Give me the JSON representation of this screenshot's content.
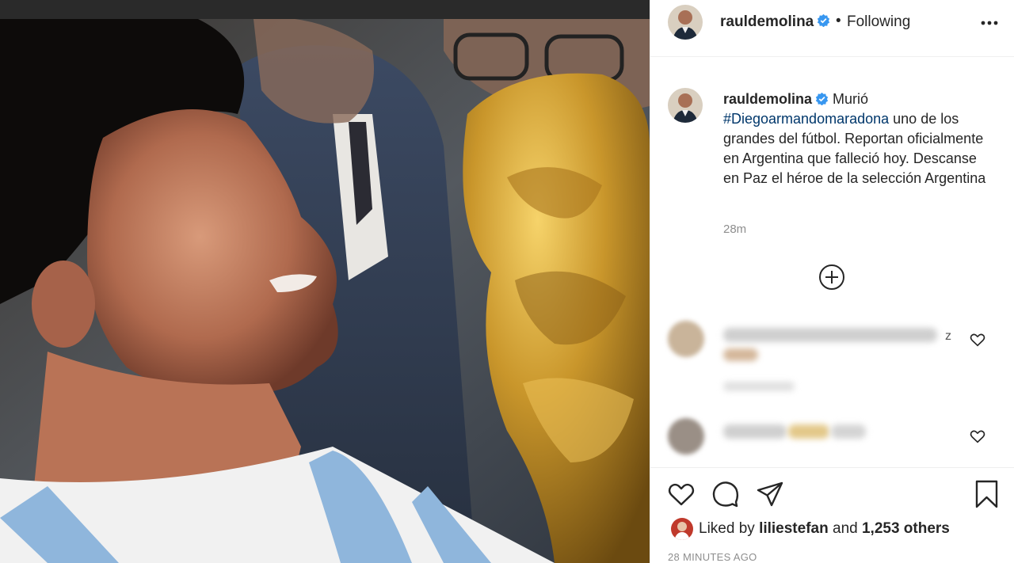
{
  "post": {
    "username": "rauldemolina",
    "following_label": "Following",
    "dot": "•",
    "caption": {
      "username": "rauldemolina",
      "text_before": "Murió",
      "hashtag": "#Diegoarmandomaradona",
      "text_after": "uno de los grandes del fútbol. Reportan oficialmente en Argentina que falleció hoy. Descanse en Paz el héroe de la selección Argentina"
    },
    "caption_time": "28m",
    "comment_partial_letter": "z",
    "likes": {
      "prefix": "Liked by",
      "user": "liliestefan",
      "middle": "and",
      "others": "1,253 others"
    },
    "timestamp": "28 MINUTES AGO"
  },
  "icons": {
    "verified": "verified-badge-icon",
    "more": "more-options-icon",
    "load_more": "load-more-comments-icon",
    "like": "heart-icon",
    "comment": "comment-icon",
    "share": "share-icon",
    "save": "bookmark-icon"
  },
  "colors": {
    "verified_blue": "#3897f0",
    "hashtag_blue": "#00376b",
    "muted": "#8e8e8e",
    "text": "#262626"
  }
}
